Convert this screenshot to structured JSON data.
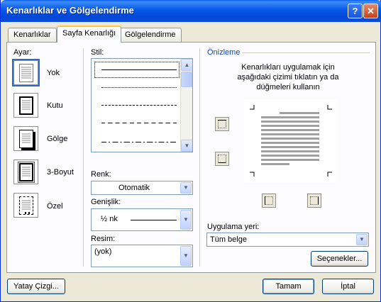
{
  "window": {
    "title": "Kenarlıklar ve Gölgelendirme"
  },
  "titlebar": {
    "help_label": "?",
    "close_label": "✕"
  },
  "tabs": [
    {
      "label": "Kenarlıklar",
      "active": false
    },
    {
      "label": "Sayfa Kenarlığı",
      "active": true
    },
    {
      "label": "Gölgelendirme",
      "active": false
    }
  ],
  "settings": {
    "label": "Ayar:",
    "items": [
      {
        "label": "Yok",
        "icon": "page-none-icon",
        "selected": true
      },
      {
        "label": "Kutu",
        "icon": "page-box-icon",
        "selected": false
      },
      {
        "label": "Gölge",
        "icon": "page-shadow-icon",
        "selected": false
      },
      {
        "label": "3-Boyut",
        "icon": "page-3d-icon",
        "selected": false
      },
      {
        "label": "Özel",
        "icon": "page-custom-icon",
        "selected": false
      }
    ]
  },
  "style": {
    "label": "Stil:"
  },
  "color": {
    "label": "Renk:",
    "value": "Otomatik"
  },
  "width": {
    "label": "Genişlik:",
    "value": "½ nk"
  },
  "art": {
    "label": "Resim:",
    "value": "(yok)"
  },
  "preview": {
    "label": "Önizleme",
    "instruction": "Kenarlıkları uygulamak için aşağıdaki çizimi tıklatın ya da düğmeleri kullanın"
  },
  "apply_to": {
    "label": "Uygulama yeri:",
    "value": "Tüm belge"
  },
  "buttons": {
    "options": "Seçenekler...",
    "horizontal_line": "Yatay Çizgi...",
    "ok": "Tamam",
    "cancel": "İptal"
  },
  "colors": {
    "titlebar": "#0a5ef2",
    "dialog": "#ece9d8",
    "accent_tab": "#ffc83c",
    "group_label": "#0046d5"
  }
}
